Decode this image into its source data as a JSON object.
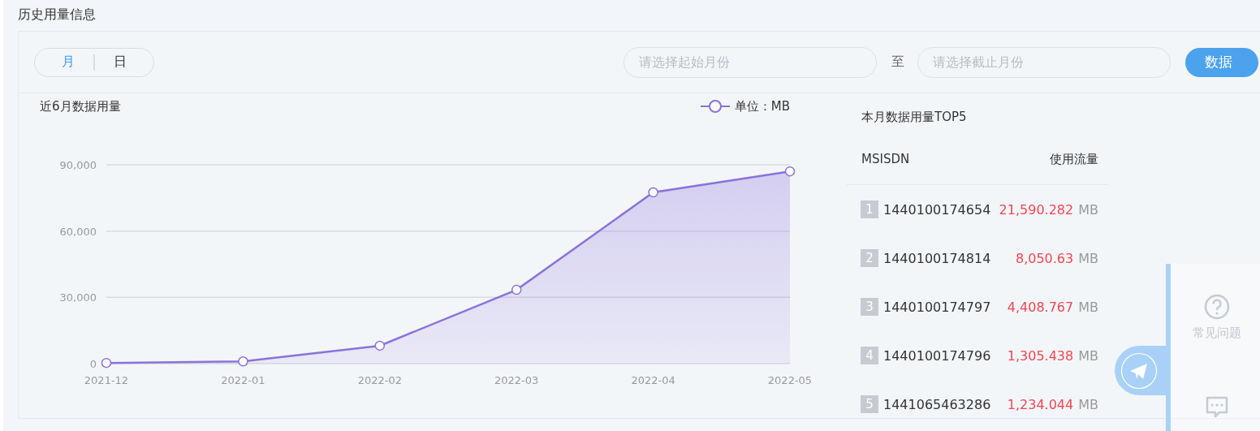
{
  "page_title": "历史用量信息",
  "period_toggle": [
    {
      "label": "月",
      "selected": true
    },
    {
      "label": "日",
      "selected": false
    }
  ],
  "start_month": {
    "placeholder": "请选择起始月份"
  },
  "range_separator": "至",
  "end_month": {
    "placeholder": "请选择截止月份"
  },
  "action_button": "数据",
  "usage_chart": {
    "title": "近6月数据用量",
    "chart_data": {
      "type": "area",
      "categories": [
        "2021-12",
        "2022-01",
        "2022-02",
        "2022-03",
        "2022-04",
        "2022-05"
      ],
      "series": [
        {
          "name": "单位：MB",
          "color": "#8b72dc",
          "values": [
            300,
            1000,
            8100,
            33400,
            77500,
            87000
          ]
        }
      ],
      "ylim": [
        0,
        90000
      ],
      "yticks": [
        {
          "value": 0,
          "label": "0"
        },
        {
          "value": 30000,
          "label": "30,000"
        },
        {
          "value": 60000,
          "label": "60,000"
        },
        {
          "value": 90000,
          "label": "90,000"
        }
      ]
    }
  },
  "top5": {
    "title": "本月数据用量TOP5",
    "columns": [
      "MSISDN",
      "使用流量"
    ],
    "rows": [
      {
        "rank": "1",
        "msisdn": "1440100174654",
        "usage": "21,590.282",
        "unit": "MB"
      },
      {
        "rank": "2",
        "msisdn": "1440100174814",
        "usage": "8,050.63",
        "unit": "MB"
      },
      {
        "rank": "3",
        "msisdn": "1440100174797",
        "usage": "4,408.767",
        "unit": "MB"
      },
      {
        "rank": "4",
        "msisdn": "1440100174796",
        "usage": "1,305.438",
        "unit": "MB"
      },
      {
        "rank": "5",
        "msisdn": "1441065463286",
        "usage": "1,234.044",
        "unit": "MB"
      }
    ]
  },
  "help_widget": {
    "label": "常见问题"
  }
}
